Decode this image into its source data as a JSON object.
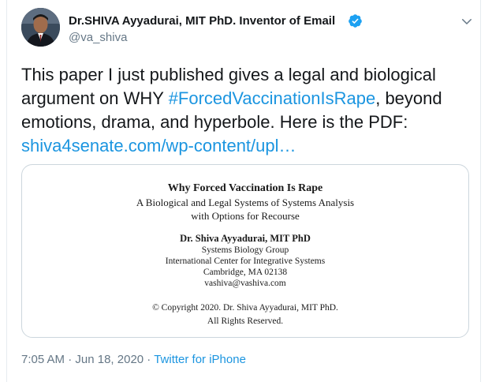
{
  "author": {
    "display_name": "Dr.SHIVA Ayyadurai, MIT PhD. Inventor of Email",
    "handle": "@va_shiva",
    "verified_icon": "verified-badge-icon",
    "caret_icon": "chevron-down-icon"
  },
  "tweet": {
    "text_part1": "This paper I just published gives a legal and biological argument on WHY ",
    "hashtag": "#ForcedVaccinationIsRape",
    "text_part2": ", beyond emotions, drama, and hyperbole. Here is the PDF: ",
    "link": "shiva4senate.com/wp-content/upl…"
  },
  "pdf_preview": {
    "title": "Why Forced Vaccination Is Rape",
    "subtitle_line1": "A Biological and Legal Systems of Systems Analysis",
    "subtitle_line2": "with Options for Recourse",
    "author": "Dr. Shiva Ayyadurai, MIT PhD",
    "affiliation_line1": "Systems Biology Group",
    "affiliation_line2": "International Center for Integrative Systems",
    "address": "Cambridge, MA 02138",
    "email": "vashiva@vashiva.com",
    "copyright_line1": "© Copyright 2020. Dr. Shiva Ayyadurai, MIT PhD.",
    "copyright_line2": "All Rights Reserved."
  },
  "meta": {
    "time": "7:05 AM",
    "separator": " · ",
    "date": "Jun 18, 2020",
    "source": "Twitter for iPhone"
  },
  "colors": {
    "link": "#1b95e0",
    "secondary_text": "#657786",
    "verified": "#1da1f2"
  }
}
